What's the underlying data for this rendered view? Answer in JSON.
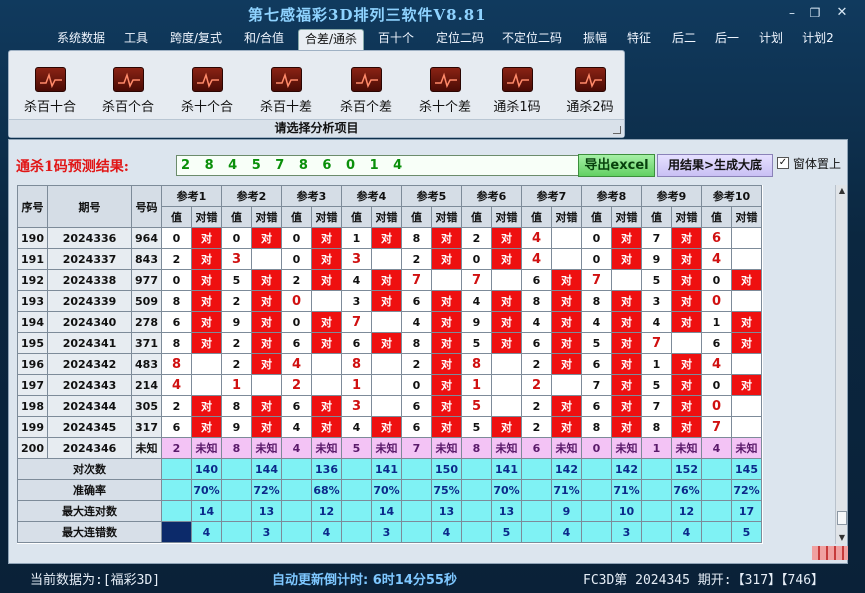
{
  "app": {
    "title": "第七感福彩3D排列三软件V8.81"
  },
  "window_controls": {
    "minimize": "–",
    "maximize": "❐",
    "close": "✕"
  },
  "menu": [
    {
      "label": "系统数据"
    },
    {
      "label": "工具"
    },
    {
      "label": "跨度/复式"
    },
    {
      "label": "和/合值"
    },
    {
      "label": "合差/通杀",
      "active": true
    },
    {
      "label": "百十个"
    },
    {
      "label": "定位二码"
    },
    {
      "label": "不定位二码"
    },
    {
      "label": "振幅"
    },
    {
      "label": "特征"
    },
    {
      "label": "后二"
    },
    {
      "label": "后一"
    },
    {
      "label": "计划"
    },
    {
      "label": "计划2"
    }
  ],
  "ribbon": {
    "tools": [
      "杀百十合",
      "杀百个合",
      "杀十个合",
      "杀百十差",
      "杀百个差",
      "杀十个差",
      "通杀1码",
      "通杀2码"
    ],
    "icon": "chart-line-icon",
    "footer": "请选择分析项目"
  },
  "prediction": {
    "label": "通杀1码预测结果:",
    "value": "2 8 4 5 7 8 6 0 1 4",
    "export_button": "导出excel",
    "generate_button": "用结果>生成大底",
    "topmost_label": "窗体置上",
    "topmost_checked": true
  },
  "table": {
    "fixed_headers": [
      "序号",
      "期号",
      "号码"
    ],
    "ref_headers": [
      "参考1",
      "参考2",
      "参考3",
      "参考4",
      "参考5",
      "参考6",
      "参考7",
      "参考8",
      "参考9",
      "参考10"
    ],
    "sub_headers": [
      "值",
      "对错"
    ],
    "hit_text": "对",
    "rows": [
      {
        "seq": "190",
        "period": "2024336",
        "number": "964",
        "refs": [
          [
            "0",
            1
          ],
          [
            "0",
            1
          ],
          [
            "0",
            1
          ],
          [
            "1",
            1
          ],
          [
            "8",
            1
          ],
          [
            "2",
            1
          ],
          [
            "4",
            0
          ],
          [
            "0",
            1
          ],
          [
            "7",
            1
          ],
          [
            "6",
            0
          ]
        ]
      },
      {
        "seq": "191",
        "period": "2024337",
        "number": "843",
        "refs": [
          [
            "2",
            1
          ],
          [
            "3",
            0
          ],
          [
            "0",
            1
          ],
          [
            "3",
            0
          ],
          [
            "2",
            1
          ],
          [
            "0",
            1
          ],
          [
            "4",
            0
          ],
          [
            "0",
            1
          ],
          [
            "9",
            1
          ],
          [
            "4",
            0
          ]
        ]
      },
      {
        "seq": "192",
        "period": "2024338",
        "number": "977",
        "refs": [
          [
            "0",
            1
          ],
          [
            "5",
            1
          ],
          [
            "2",
            1
          ],
          [
            "4",
            1
          ],
          [
            "7",
            0
          ],
          [
            "7",
            0
          ],
          [
            "6",
            1
          ],
          [
            "7",
            0
          ],
          [
            "5",
            1
          ],
          [
            "0",
            1
          ]
        ]
      },
      {
        "seq": "193",
        "period": "2024339",
        "number": "509",
        "refs": [
          [
            "8",
            1
          ],
          [
            "2",
            1
          ],
          [
            "0",
            0
          ],
          [
            "3",
            1
          ],
          [
            "6",
            1
          ],
          [
            "4",
            1
          ],
          [
            "8",
            1
          ],
          [
            "8",
            1
          ],
          [
            "3",
            1
          ],
          [
            "0",
            0
          ]
        ]
      },
      {
        "seq": "194",
        "period": "2024340",
        "number": "278",
        "refs": [
          [
            "6",
            1
          ],
          [
            "9",
            1
          ],
          [
            "0",
            1
          ],
          [
            "7",
            0
          ],
          [
            "4",
            1
          ],
          [
            "9",
            1
          ],
          [
            "4",
            1
          ],
          [
            "4",
            1
          ],
          [
            "4",
            1
          ],
          [
            "1",
            1
          ]
        ]
      },
      {
        "seq": "195",
        "period": "2024341",
        "number": "371",
        "refs": [
          [
            "8",
            1
          ],
          [
            "2",
            1
          ],
          [
            "6",
            1
          ],
          [
            "6",
            1
          ],
          [
            "8",
            1
          ],
          [
            "5",
            1
          ],
          [
            "6",
            1
          ],
          [
            "5",
            1
          ],
          [
            "7",
            0
          ],
          [
            "6",
            1
          ]
        ]
      },
      {
        "seq": "196",
        "period": "2024342",
        "number": "483",
        "refs": [
          [
            "8",
            0
          ],
          [
            "2",
            1
          ],
          [
            "4",
            0
          ],
          [
            "8",
            0
          ],
          [
            "2",
            1
          ],
          [
            "8",
            0
          ],
          [
            "2",
            1
          ],
          [
            "6",
            1
          ],
          [
            "1",
            1
          ],
          [
            "4",
            0
          ]
        ]
      },
      {
        "seq": "197",
        "period": "2024343",
        "number": "214",
        "refs": [
          [
            "4",
            0
          ],
          [
            "1",
            0
          ],
          [
            "2",
            0
          ],
          [
            "1",
            0
          ],
          [
            "0",
            1
          ],
          [
            "1",
            0
          ],
          [
            "2",
            0
          ],
          [
            "7",
            1
          ],
          [
            "5",
            1
          ],
          [
            "0",
            1
          ]
        ]
      },
      {
        "seq": "198",
        "period": "2024344",
        "number": "305",
        "refs": [
          [
            "2",
            1
          ],
          [
            "8",
            1
          ],
          [
            "6",
            1
          ],
          [
            "3",
            0
          ],
          [
            "6",
            1
          ],
          [
            "5",
            0
          ],
          [
            "2",
            1
          ],
          [
            "6",
            1
          ],
          [
            "7",
            1
          ],
          [
            "0",
            0
          ]
        ]
      },
      {
        "seq": "199",
        "period": "2024345",
        "number": "317",
        "refs": [
          [
            "6",
            1
          ],
          [
            "9",
            1
          ],
          [
            "4",
            1
          ],
          [
            "4",
            1
          ],
          [
            "6",
            1
          ],
          [
            "5",
            1
          ],
          [
            "2",
            1
          ],
          [
            "8",
            1
          ],
          [
            "8",
            1
          ],
          [
            "7",
            0
          ]
        ]
      }
    ],
    "pending": {
      "seq": "200",
      "period": "2024346",
      "number": "未知",
      "values": [
        "2",
        "8",
        "4",
        "5",
        "7",
        "8",
        "6",
        "0",
        "1",
        "4"
      ],
      "result": "未知"
    },
    "stats": [
      {
        "label": "对次数",
        "values": [
          "140",
          "144",
          "136",
          "141",
          "150",
          "141",
          "142",
          "142",
          "152",
          "145"
        ]
      },
      {
        "label": "准确率",
        "values": [
          "70%",
          "72%",
          "68%",
          "70%",
          "75%",
          "70%",
          "71%",
          "71%",
          "76%",
          "72%"
        ]
      },
      {
        "label": "最大连对数",
        "values": [
          "14",
          "13",
          "12",
          "14",
          "13",
          "13",
          "9",
          "10",
          "12",
          "17"
        ]
      },
      {
        "label": "最大连错数",
        "values": [
          "4",
          "3",
          "4",
          "3",
          "4",
          "5",
          "4",
          "3",
          "4",
          "5"
        ]
      }
    ]
  },
  "status": {
    "current_data": "当前数据为:[福彩3D]",
    "countdown": "自动更新倒计时: 6时14分55秒",
    "draw_info": "FC3D第 2024345 期开:【317】【746】"
  },
  "colors": {
    "hit": "#ee1010",
    "stats_bg": "#7ff2f4",
    "pending_bg": "#f3c3f5",
    "title": "#8fd3ff"
  }
}
